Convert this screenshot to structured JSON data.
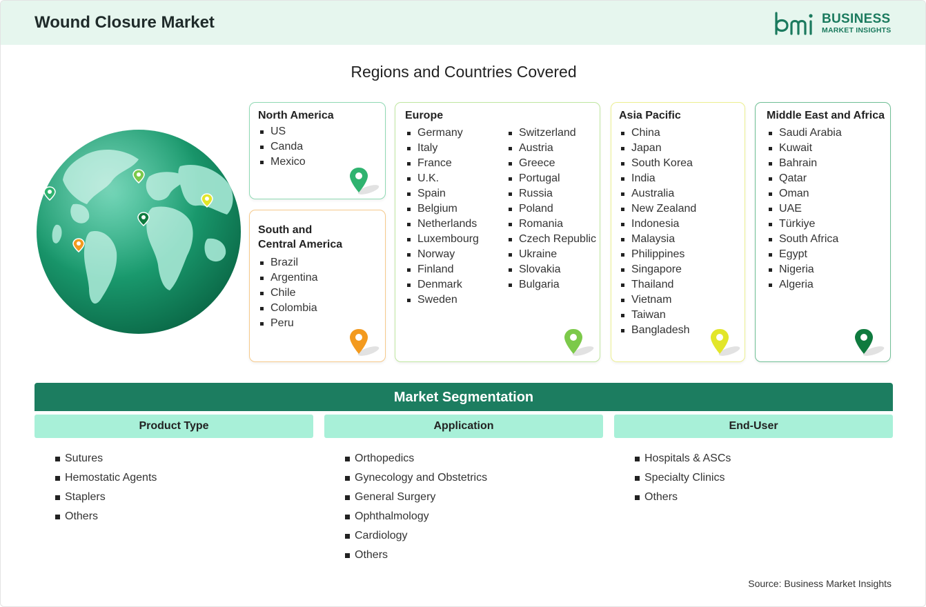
{
  "header": {
    "title": "Wound Closure Market"
  },
  "logo": {
    "line1": "BUSINESS",
    "line2": "MARKET INSIGHTS",
    "color": "#1b7a5e"
  },
  "regions_title": "Regions and Countries Covered",
  "regions": {
    "north_america": {
      "name": "North America",
      "countries": [
        "US",
        "Canda",
        "Mexico"
      ],
      "color": "#2fb36f"
    },
    "south_america": {
      "name_line1": "South and",
      "name_line2": "Central America",
      "countries": [
        "Brazil",
        "Argentina",
        "Chile",
        "Colombia",
        "Peru"
      ],
      "color": "#f39a1e"
    },
    "europe": {
      "name": "Europe",
      "countries_col1": [
        "Germany",
        "Italy",
        "France",
        "U.K.",
        "Spain",
        "Belgium",
        "Netherlands",
        "Luxembourg",
        "Norway",
        "Finland",
        "Denmark",
        "Sweden"
      ],
      "countries_col2": [
        "Switzerland",
        "Austria",
        "Greece",
        "Portugal",
        "Russia",
        "Poland",
        "Romania",
        "Czech Republic",
        "Ukraine",
        "Slovakia",
        "Bulgaria"
      ],
      "color": "#7cc94a"
    },
    "asia_pacific": {
      "name": "Asia Pacific",
      "countries": [
        "China",
        "Japan",
        "South Korea",
        "India",
        "Australia",
        "New Zealand",
        "Indonesia",
        "Malaysia",
        "Philippines",
        "Singapore",
        "Thailand",
        "Vietnam",
        "Taiwan",
        "Bangladesh"
      ],
      "color": "#e2e62a"
    },
    "mea": {
      "name": "Middle East and Africa",
      "countries": [
        "Saudi Arabia",
        "Kuwait",
        "Bahrain",
        "Qatar",
        "Oman",
        "UAE",
        "Türkiye",
        "South Africa",
        "Egypt",
        "Nigeria",
        "Algeria"
      ],
      "color": "#0f7a3e"
    }
  },
  "segmentation": {
    "title": "Market Segmentation",
    "columns": [
      {
        "title": "Product Type",
        "items": [
          "Sutures",
          "Hemostatic Agents",
          "Staplers",
          "Others"
        ]
      },
      {
        "title": "Application",
        "items": [
          "Orthopedics",
          "Gynecology and Obstetrics",
          "General Surgery",
          "Ophthalmology",
          "Cardiology",
          "Others"
        ]
      },
      {
        "title": "End-User",
        "items": [
          "Hospitals & ASCs",
          "Specialty Clinics",
          "Others"
        ]
      }
    ],
    "bar_color": "#1c7d60",
    "header_color": "#a8f0d8"
  },
  "source": "Source: Business Market Insights",
  "icons": [
    "globe-icon",
    "map-pin-icon",
    "logo-mark-icon"
  ]
}
